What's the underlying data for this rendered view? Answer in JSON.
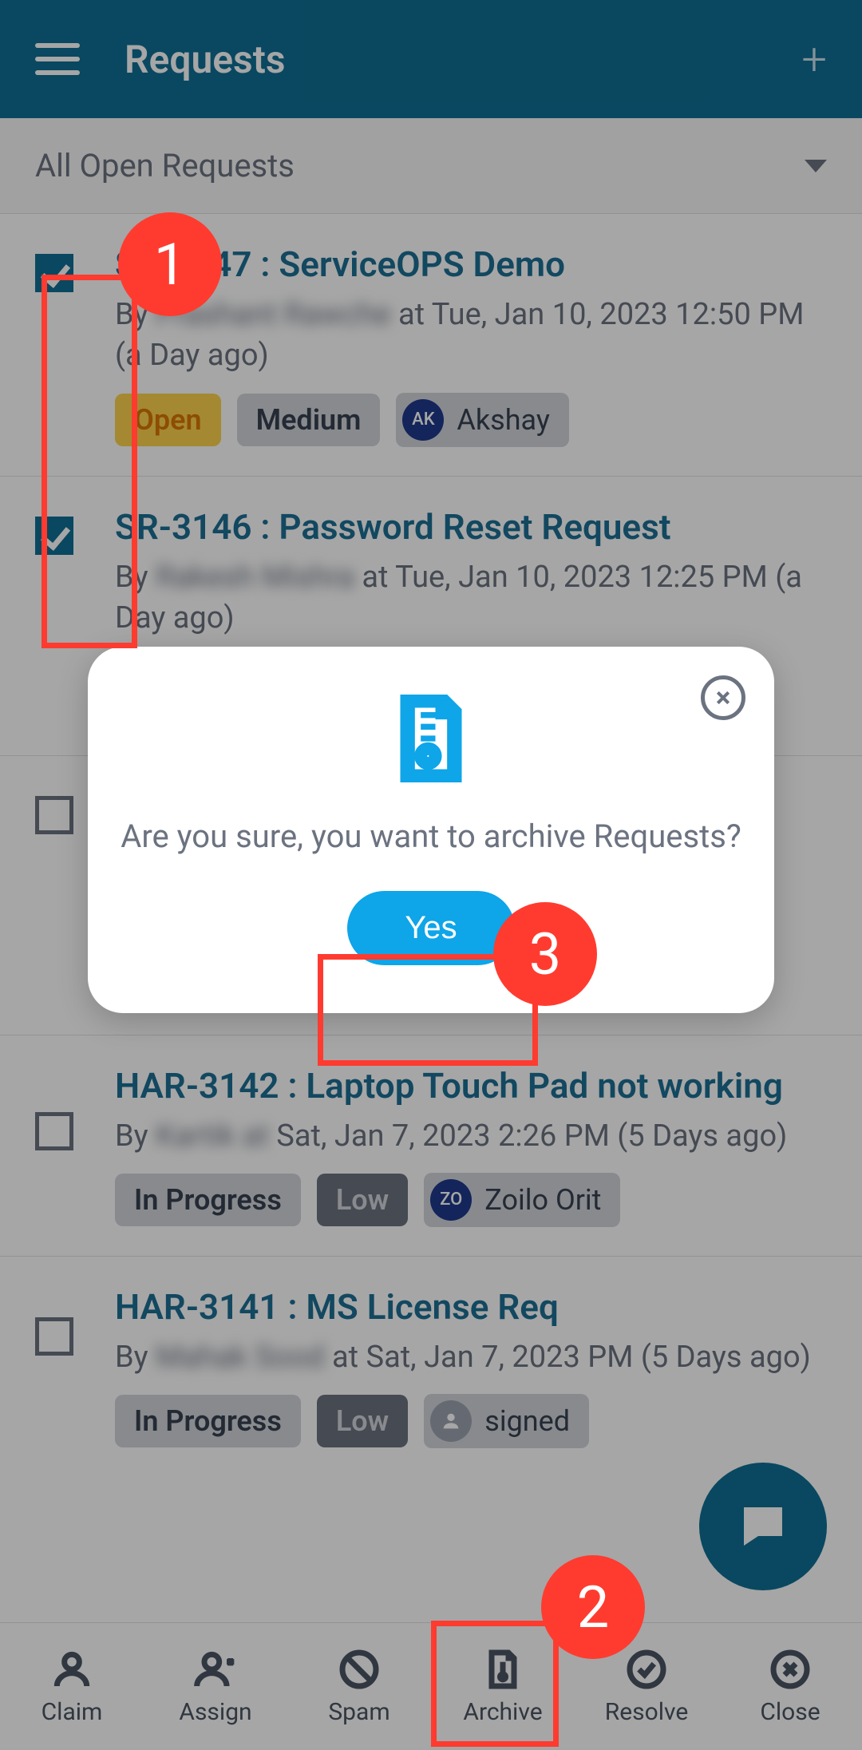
{
  "header": {
    "title": "Requests"
  },
  "filter": {
    "label": "All Open Requests"
  },
  "rows": [
    {
      "checked": true,
      "title": "SR-3147 : ServiceOPS Demo",
      "by_prefix": "By ",
      "author_blurred": "Prashant Rawche",
      "time": " at Tue, Jan 10, 2023 12:50 PM (a Day ago)",
      "status": "Open",
      "status_class": "pill-open",
      "priority": "Medium",
      "priority_class": "pill-medium",
      "avatar_initials": "AK",
      "assignee": "Akshay"
    },
    {
      "checked": true,
      "title": "SR-3146 : Password Reset Request",
      "by_prefix": "By ",
      "author_blurred": "Rakesh Mishra",
      "time": " at Tue, Jan 10, 2023 12:25 PM (a Day ago)",
      "status": "",
      "status_class": "",
      "priority": "",
      "priority_class": "",
      "avatar_initials": "",
      "assignee": ""
    },
    {
      "checked": false,
      "title": "",
      "by_prefix": "",
      "author_blurred": "",
      "time": "",
      "status": "",
      "status_class": "",
      "priority": "",
      "priority_class": "",
      "avatar_initials": "",
      "assignee": ""
    },
    {
      "checked": false,
      "title": "HAR-3142 : Laptop Touch Pad not working",
      "by_prefix": "By ",
      "author_blurred": "Kartik at",
      "time": " Sat, Jan 7, 2023 2:26 PM (5 Days ago)",
      "status": "In Progress",
      "status_class": "pill-progress",
      "priority": "Low",
      "priority_class": "pill-low",
      "avatar_initials": "ZO",
      "assignee": "Zoilo Orit"
    },
    {
      "checked": false,
      "title": "HAR-3141 : MS License Req",
      "by_prefix": "By ",
      "author_blurred": "Mahak Sood",
      "time": " at Sat, Jan 7, 2023 PM (5 Days ago)",
      "status": "In Progress",
      "status_class": "pill-progress",
      "priority": "Low",
      "priority_class": "pill-low",
      "avatar_initials": "",
      "assignee": "signed"
    }
  ],
  "bottom": {
    "claim": "Claim",
    "assign": "Assign",
    "spam": "Spam",
    "archive": "Archive",
    "resolve": "Resolve",
    "close": "Close"
  },
  "modal": {
    "text": "Are you sure, you want to archive Requests?",
    "yes": "Yes"
  },
  "callouts": {
    "c1": "1",
    "c2": "2",
    "c3": "3"
  }
}
